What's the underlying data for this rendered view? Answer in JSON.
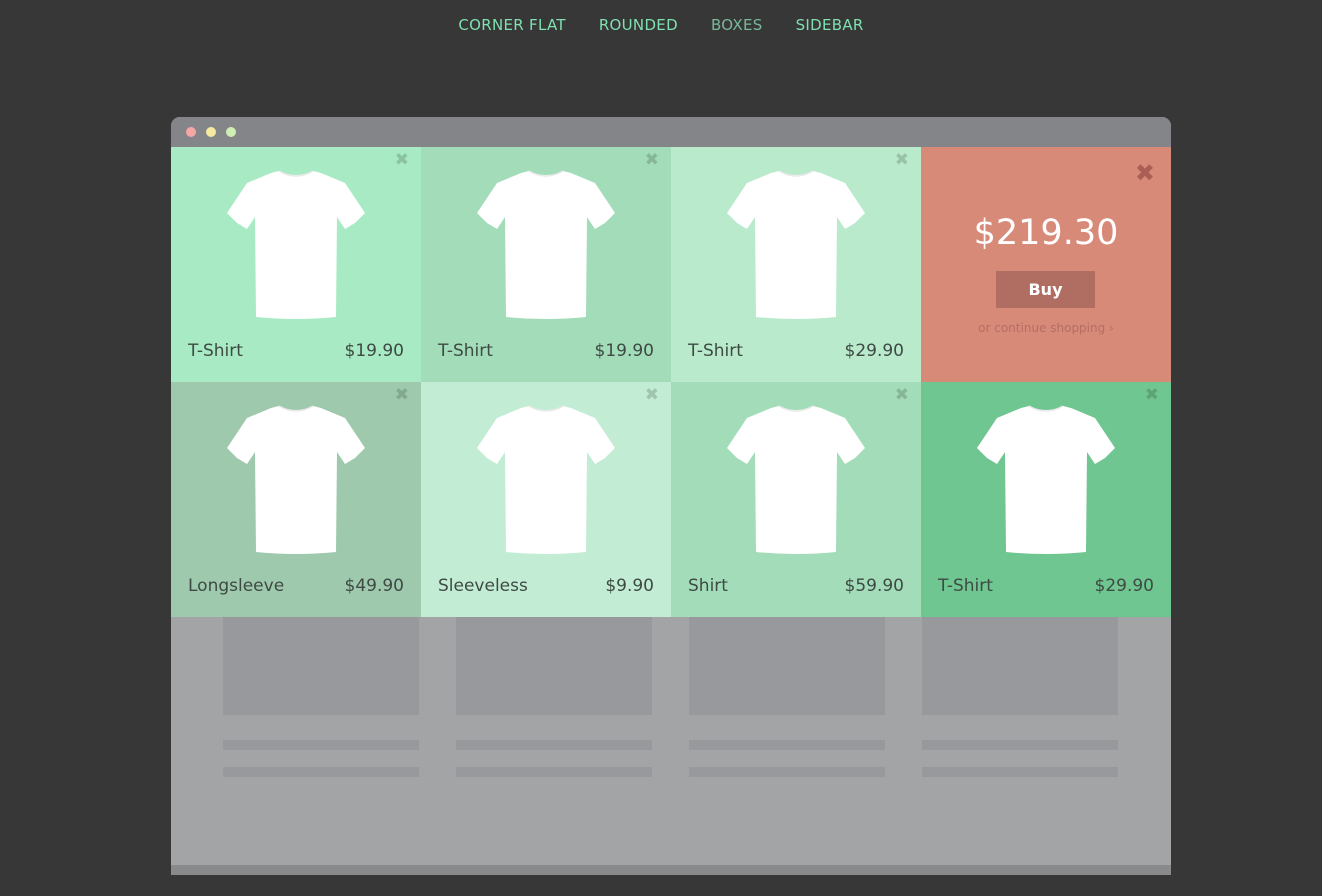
{
  "nav": {
    "items": [
      {
        "label": "CORNER FLAT"
      },
      {
        "label": "ROUNDED"
      },
      {
        "label": "BOXES"
      },
      {
        "label": "SIDEBAR"
      }
    ],
    "active": "BOXES"
  },
  "products": [
    {
      "name": "T-Shirt",
      "price": "$19.90",
      "color": "#a7eac3"
    },
    {
      "name": "T-Shirt",
      "price": "$19.90",
      "color": "#a2dcb8"
    },
    {
      "name": "T-Shirt",
      "price": "$29.90",
      "color": "#b9eacb"
    },
    {
      "name": "Longsleeve",
      "price": "$49.90",
      "color": "#9ec9ad"
    },
    {
      "name": "Sleeveless",
      "price": "$9.90",
      "color": "#c2ecd3"
    },
    {
      "name": "Shirt",
      "price": "$59.90",
      "color": "#a2dcb8"
    },
    {
      "name": "T-Shirt",
      "price": "$29.90",
      "color": "#6fc690"
    }
  ],
  "checkout": {
    "total": "$219.30",
    "buy_label": "Buy",
    "continue_label": "or continue shopping ›",
    "color": "#d88a78"
  },
  "icons": {
    "remove": "close-icon",
    "checkout_close": "close-icon",
    "product_image": "tshirt-icon"
  }
}
